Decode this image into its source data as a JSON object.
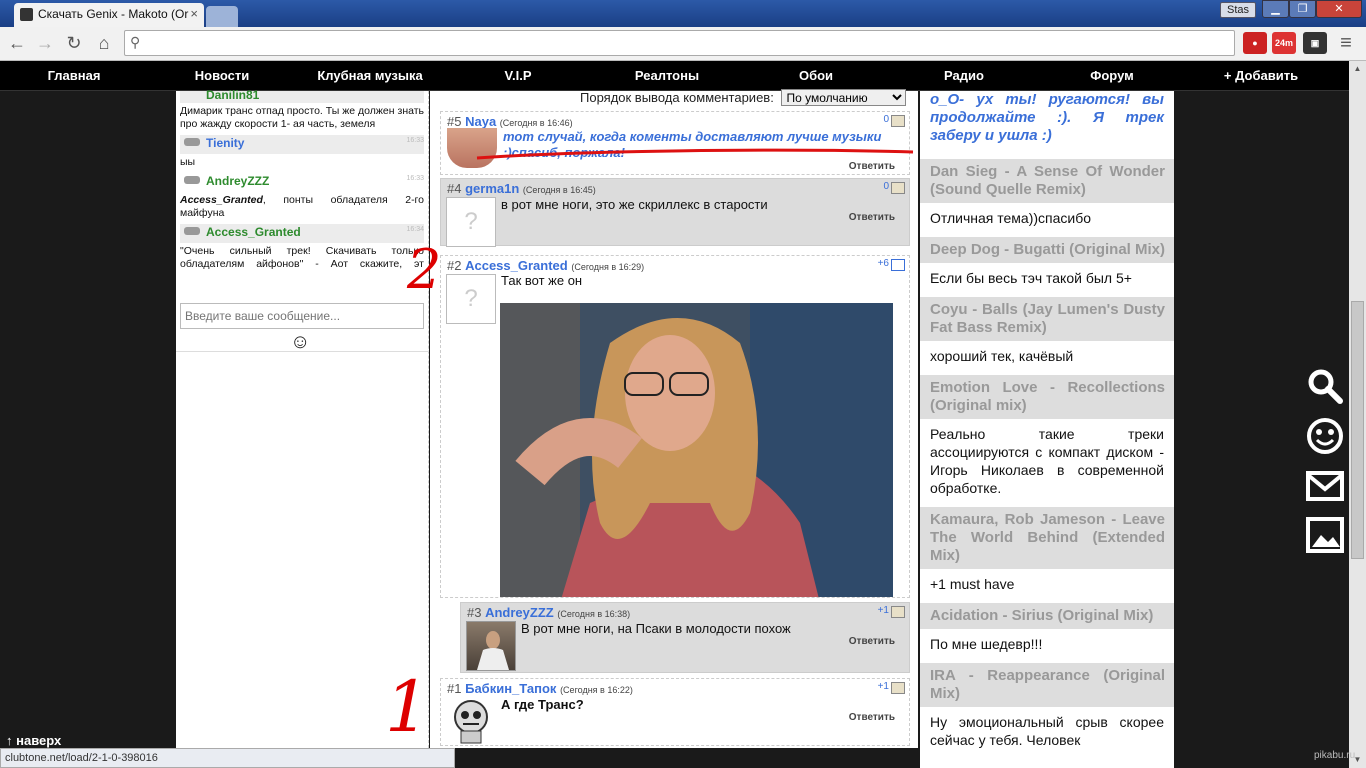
{
  "browser": {
    "tab_title": "Скачать Genix - Makoto (Or",
    "user_badge": "Stas",
    "url_value": ""
  },
  "nav": {
    "items": [
      "Главная",
      "Новости",
      "Клубная музыка",
      "V.I.P",
      "Реалтоны",
      "Обои",
      "Радио",
      "Форум",
      "+ Добавить"
    ]
  },
  "chat": {
    "messages": [
      {
        "name": "Danilin81",
        "name_color": "green",
        "time": "",
        "text": "Димарик транс отпад просто. Ты же должен знать про жажду скорости 1- ая часть, земеля"
      },
      {
        "name": "Tienity",
        "name_color": "blue",
        "time": "16:33",
        "text": "ыы"
      },
      {
        "name": "AndreyZZZ",
        "name_color": "green",
        "time": "16:33",
        "text_author": "Access_Granted",
        "text": ", понты обладателя 2-го майфуна"
      },
      {
        "name": "Access_Granted",
        "name_color": "green",
        "time": "16:34",
        "text": "\"Очень сильный трек! Скачивать только обладателям айфонов\" - Аот скажите, эт нормальные люди вообще? ))"
      }
    ],
    "input_placeholder": "Введите ваше сообщение..."
  },
  "comments": {
    "order_label": "Порядок вывода комментариев:",
    "order_value": "По умолчанию",
    "reply_label": "Ответить",
    "items": [
      {
        "num": "#5",
        "author": "Naya",
        "when": "(Сегодня в 16:46)",
        "rating": "0",
        "text": "тот случай, когда коменты доставляют лучше музыки :)спасиб, поржала!"
      },
      {
        "num": "#4",
        "author": "germa1n",
        "when": "(Сегодня в 16:45)",
        "rating": "0",
        "text": "в рот мне ноги, это же скриллекс в старости"
      },
      {
        "num": "#2",
        "author": "Access_Granted",
        "when": "(Сегодня в 16:29)",
        "rating": "+6",
        "text": "Так вот же он"
      },
      {
        "num": "#3",
        "author": "AndreyZZZ",
        "when": "(Сегодня в 16:38)",
        "rating": "+1",
        "text": "В рот мне ноги, на Псаки в молодости похож"
      },
      {
        "num": "#1",
        "author": "Бабкин_Тапок",
        "when": "(Сегодня в 16:22)",
        "rating": "+1",
        "text": "А где Транс?"
      }
    ]
  },
  "sidebar": {
    "top_text": "o_O- ух ты! ругаются! вы продолжайте :). Я трек заберу и ушла :)",
    "items": [
      {
        "track": "Dan Sieg - A Sense Of Wonder (Sound Quelle Remix)",
        "comment": "Отличная тема))спасибо"
      },
      {
        "track": "Deep Dog - Bugatti (Original Mix)",
        "comment": "Если бы весь тэч такой был 5+"
      },
      {
        "track": "Coyu - Balls (Jay Lumen's Dusty Fat Bass Remix)",
        "comment": "хороший тек, качёвый"
      },
      {
        "track": "Emotion Love - Recollections (Original mix)",
        "comment": "Реально такие треки ассоциируются с компакт диском - Игорь Николаев в современной обработке."
      },
      {
        "track": "Kamaura, Rob Jameson - Leave The World Behind (Extended Mix)",
        "comment": "+1 must have"
      },
      {
        "track": "Acidation - Sirius (Original Mix)",
        "comment": "По мне шедевр!!!"
      },
      {
        "track": "IRA - Reappearance (Original Mix)",
        "comment": "Ну эмоциональный срыв скорее сейчас у тебя. Человек"
      }
    ]
  },
  "footer": {
    "top_link": "↑ наверх",
    "status_url": "clubtone.net/load/2-1-0-398016",
    "watermark": "pikabu.ru"
  },
  "annotations": {
    "mark1": "1",
    "mark2": "2"
  },
  "icons": [
    "search-icon",
    "smiley-icon",
    "mail-icon",
    "image-icon"
  ]
}
